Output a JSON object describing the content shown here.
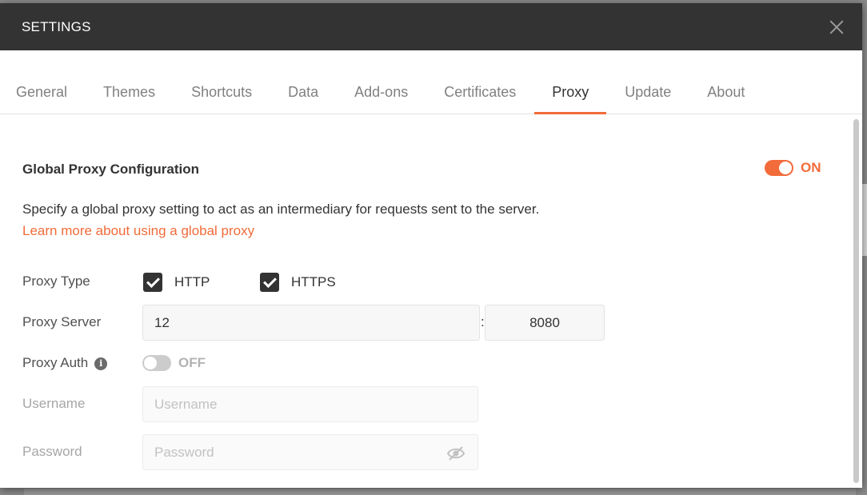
{
  "modal": {
    "title": "SETTINGS",
    "close_icon": "close-icon"
  },
  "tabs": [
    {
      "label": "General",
      "active": false
    },
    {
      "label": "Themes",
      "active": false
    },
    {
      "label": "Shortcuts",
      "active": false
    },
    {
      "label": "Data",
      "active": false
    },
    {
      "label": "Add-ons",
      "active": false
    },
    {
      "label": "Certificates",
      "active": false
    },
    {
      "label": "Proxy",
      "active": true
    },
    {
      "label": "Update",
      "active": false
    },
    {
      "label": "About",
      "active": false
    }
  ],
  "proxy": {
    "section_title": "Global Proxy Configuration",
    "global_toggle": {
      "state": "ON",
      "enabled": true
    },
    "description": "Specify a global proxy setting to act as an intermediary for requests sent to the server.",
    "learn_more_link": "Learn more about using a global proxy",
    "proxy_type": {
      "label": "Proxy Type",
      "http": {
        "label": "HTTP",
        "checked": true
      },
      "https": {
        "label": "HTTPS",
        "checked": true
      }
    },
    "proxy_server": {
      "label": "Proxy Server",
      "host_value": "12",
      "separator": ":",
      "port_value": "8080"
    },
    "proxy_auth": {
      "label": "Proxy Auth",
      "info_icon": "info-icon",
      "toggle_state": "OFF",
      "enabled": false
    },
    "username": {
      "label": "Username",
      "placeholder": "Username",
      "value": ""
    },
    "password": {
      "label": "Password",
      "placeholder": "Password",
      "value": "",
      "visibility_icon": "eye-slash-icon"
    }
  },
  "colors": {
    "accent": "#f26b3a",
    "header_bg": "#333333",
    "muted_text": "#808080",
    "disabled_text": "#a6a6a6"
  }
}
